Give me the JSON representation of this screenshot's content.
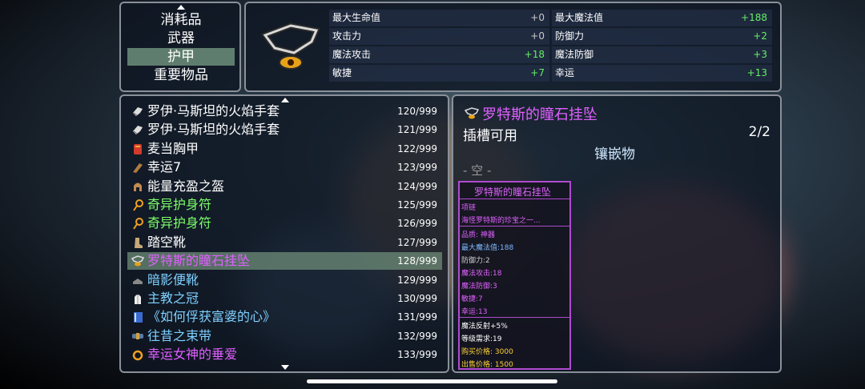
{
  "categories": {
    "items": [
      "消耗品",
      "武器",
      "护甲",
      "重要物品"
    ],
    "selected": "护甲"
  },
  "stats": [
    {
      "label": "最大生命值",
      "value": "+0",
      "positive": false
    },
    {
      "label": "最大魔法值",
      "value": "+188",
      "positive": true
    },
    {
      "label": "攻击力",
      "value": "+0",
      "positive": false
    },
    {
      "label": "防御力",
      "value": "+2",
      "positive": true
    },
    {
      "label": "魔法攻击",
      "value": "+18",
      "positive": true
    },
    {
      "label": "魔法防御",
      "value": "+3",
      "positive": true
    },
    {
      "label": "敏捷",
      "value": "+7",
      "positive": true
    },
    {
      "label": "幸运",
      "value": "+13",
      "positive": true
    }
  ],
  "items": [
    {
      "name": "罗伊·马斯坦的火焰手套",
      "count": "120/999",
      "color": "white",
      "icon": "glove-icon"
    },
    {
      "name": "罗伊·马斯坦的火焰手套",
      "count": "121/999",
      "color": "white",
      "icon": "glove-icon"
    },
    {
      "name": "麦当胸甲",
      "count": "122/999",
      "color": "white",
      "icon": "chest-armor-icon"
    },
    {
      "name": "幸运7",
      "count": "123/999",
      "color": "white",
      "icon": "arm-guard-icon"
    },
    {
      "name": "能量充盈之盔",
      "count": "124/999",
      "color": "white",
      "icon": "helmet-icon"
    },
    {
      "name": "奇异护身符",
      "count": "125/999",
      "color": "green",
      "icon": "amulet-icon"
    },
    {
      "name": "奇异护身符",
      "count": "126/999",
      "color": "green",
      "icon": "amulet-icon"
    },
    {
      "name": "踏空靴",
      "count": "127/999",
      "color": "white",
      "icon": "boots-icon"
    },
    {
      "name": "罗特斯的瞳石挂坠",
      "count": "128/999",
      "color": "purple",
      "icon": "pendant-icon",
      "selected": true
    },
    {
      "name": "暗影便靴",
      "count": "129/999",
      "color": "blue",
      "icon": "shoe-icon"
    },
    {
      "name": "主教之冠",
      "count": "130/999",
      "color": "blue",
      "icon": "mitre-icon"
    },
    {
      "name": "《如何俘获富婆的心》",
      "count": "131/999",
      "color": "blue",
      "icon": "book-icon"
    },
    {
      "name": "往昔之束带",
      "count": "132/999",
      "color": "blue",
      "icon": "belt-icon"
    },
    {
      "name": "幸运女神的垂爱",
      "count": "133/999",
      "color": "purple",
      "icon": "ring-icon"
    }
  ],
  "detail": {
    "title": "罗特斯的瞳石挂坠",
    "slot_label": "插槽可用",
    "slot_count": "2/2",
    "socket_title": "镶嵌物",
    "socket_empty": "- 空 -"
  },
  "tooltip": {
    "title": "罗特斯的瞳石挂坠",
    "type": "项链",
    "desc": "海怪罗特斯的珍宝之一...",
    "quality": "品质: 神器",
    "stat_lines": [
      "最大魔法值:188",
      "防御力:2",
      "魔法攻击:18",
      "魔法防御:3",
      "敏捷:7",
      "幸运:13"
    ],
    "effect": "魔法反射+5%",
    "level_req": "等级需求:19",
    "buy_price": "购买价格: 3000",
    "sell_price": "出售价格: 1500"
  },
  "colors": {
    "white": "#ffffff",
    "blue": "#7fd0ff",
    "green": "#7cff6a",
    "purple": "#e060ff"
  }
}
